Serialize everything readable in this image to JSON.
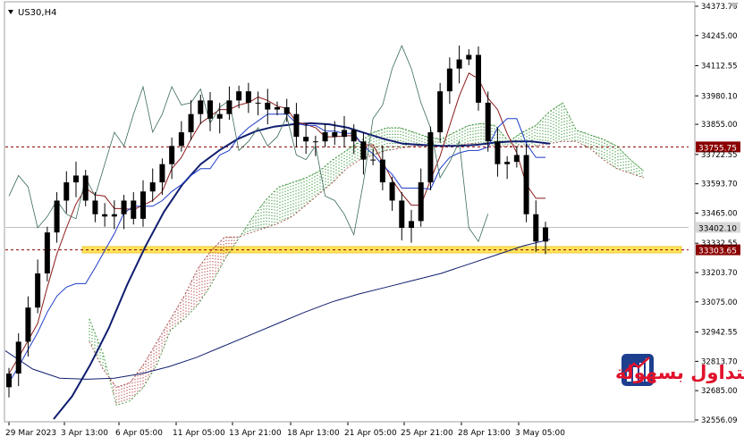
{
  "symbol": "US30,H4",
  "watermark": {
    "text": "التداول بسهولة"
  },
  "price_tags": [
    {
      "value": "33755.75",
      "color": "#8b0000",
      "kind": "resistance"
    },
    {
      "value": "33402.10",
      "color": "#d8d8d8",
      "kind": "current"
    },
    {
      "value": "33303.65",
      "color": "#8b0000",
      "kind": "support"
    }
  ],
  "chart_data": {
    "type": "line",
    "title": "US30,H4",
    "xlabel": "",
    "ylabel": "",
    "ylim": [
      32556.09,
      34373.7
    ],
    "y_ticks": [
      "34373.70",
      "34245.00",
      "34112.55",
      "33980.10",
      "33855.00",
      "33722.55",
      "33593.70",
      "33465.00",
      "33332.55",
      "33203.70",
      "33075.00",
      "32942.55",
      "32813.70",
      "32685.00",
      "32556.09"
    ],
    "x_ticks": [
      "29 Mar 2023",
      "3 Apr 13:00",
      "6 Apr 05:00",
      "11 Apr 05:00",
      "13 Apr 21:00",
      "18 Apr 13:00",
      "21 Apr 05:00",
      "25 Apr 21:00",
      "28 Apr 13:00",
      "3 May 05:00"
    ],
    "support_zone": [
      33290,
      33318
    ],
    "support_level": 33303.65,
    "resistance_level": 33755.75,
    "last_price": 33402.1,
    "series": [
      {
        "kind": "price",
        "values": [
          32760,
          32900,
          33050,
          33200,
          33380,
          33520,
          33600,
          33630,
          33520,
          33460,
          33450,
          33460,
          33520,
          33440,
          33560,
          33600,
          33680,
          33760,
          33820,
          33900,
          33960,
          33880,
          33900,
          33960,
          34000,
          33950,
          33950,
          33920,
          33930,
          33900,
          33800,
          33780,
          33780,
          33820,
          33800,
          33830,
          33780,
          33700,
          33700,
          33600,
          33520,
          33400,
          33430,
          33600,
          33820,
          34000,
          34100,
          34140,
          34160,
          33950,
          33780,
          33680,
          33690,
          33720,
          33460,
          33340,
          33402
        ]
      },
      {
        "kind": "ichimoku-span-a",
        "values": [
          33000,
          32850,
          32620,
          32640,
          32700,
          32800,
          32950,
          33000,
          33060,
          33150,
          33260,
          33350,
          33440,
          33520,
          33580,
          33600,
          33620,
          33650,
          33700,
          33740,
          33780,
          33820,
          33840,
          33840,
          33820,
          33800,
          33790,
          33820,
          33850,
          33860,
          33850,
          33780,
          33820,
          33850,
          33910,
          33950,
          33830,
          33810,
          33790,
          33760,
          33700,
          33650
        ]
      },
      {
        "kind": "ichimoku-span-b",
        "values": [
          32900,
          32780,
          32700,
          32720,
          32800,
          32900,
          33000,
          33100,
          33220,
          33300,
          33360,
          33360,
          33380,
          33400,
          33420,
          33450,
          33500,
          33550,
          33600,
          33660,
          33700,
          33720,
          33740,
          33750,
          33760,
          33760,
          33760,
          33760,
          33770,
          33770,
          33760,
          33760,
          33760,
          33760,
          33770,
          33780,
          33780,
          33750,
          33700,
          33660,
          33640,
          33620
        ]
      },
      {
        "kind": "ma-fast",
        "values": [
          32560,
          32660,
          32800,
          32960,
          33150,
          33320,
          33470,
          33590,
          33680,
          33740,
          33790,
          33825,
          33845,
          33855,
          33860,
          33855,
          33840,
          33815,
          33790,
          33770,
          33765,
          33760,
          33760,
          33765,
          33775,
          33780,
          33780,
          33770
        ]
      },
      {
        "kind": "ma-slow",
        "values": [
          32860,
          32780,
          32740,
          32735,
          32740,
          32760,
          32790,
          32830,
          32880,
          32930,
          32980,
          33030,
          33075,
          33110,
          33140,
          33170,
          33200,
          33240,
          33280,
          33320,
          33350
        ]
      }
    ]
  }
}
